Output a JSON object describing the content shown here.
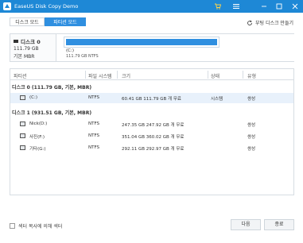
{
  "window": {
    "title": "EaseUS Disk Copy Demo"
  },
  "mode_tabs": [
    {
      "label": "디스크 모드",
      "active": false
    },
    {
      "label": "파티션 모드",
      "active": true
    }
  ],
  "boot_disk_label": "부팅 디스크 만들기",
  "disk_summary": {
    "name": "디스크 0",
    "size": "111.79 GB",
    "type": "기본 MBR",
    "partition_label": "(C:)",
    "partition_info": "111.79 GB NTFS"
  },
  "table": {
    "columns": [
      "파티션",
      "파일 시스템",
      "크기",
      "상태",
      "유형"
    ],
    "groups": [
      {
        "label": "디스크 0 (111.79 GB, 기본, MBR)",
        "rows": [
          {
            "name": "(C:)",
            "fs": "NTFS",
            "size": "60.41 GB 111.79 GB 개 무료",
            "status": "시스템",
            "type": "쌍성",
            "selected": true
          }
        ]
      },
      {
        "label": "디스크 1 (931.51 GB, 기본, MBR)",
        "rows": [
          {
            "name": "Nick(D:)",
            "fs": "NTFS",
            "size": "247.35 GB 247.92 GB 개 무료",
            "status": "",
            "type": "쌍성",
            "selected": false
          },
          {
            "name": "사진(F:)",
            "fs": "NTFS",
            "size": "351.04 GB 360.02 GB 개 무료",
            "status": "",
            "type": "쌍성",
            "selected": false
          },
          {
            "name": "기타(G:)",
            "fs": "NTFS",
            "size": "292.11 GB 292.97 GB 개 무료",
            "status": "",
            "type": "쌍성",
            "selected": false
          }
        ]
      }
    ]
  },
  "footer": {
    "sector_label": "섹터 복사에 의해 섹터",
    "next_label": "다음",
    "exit_label": "종료"
  },
  "colors": {
    "titlebar": "#1e88d6",
    "accent": "#2f8fe0",
    "selected_row": "#e8f1fb"
  }
}
